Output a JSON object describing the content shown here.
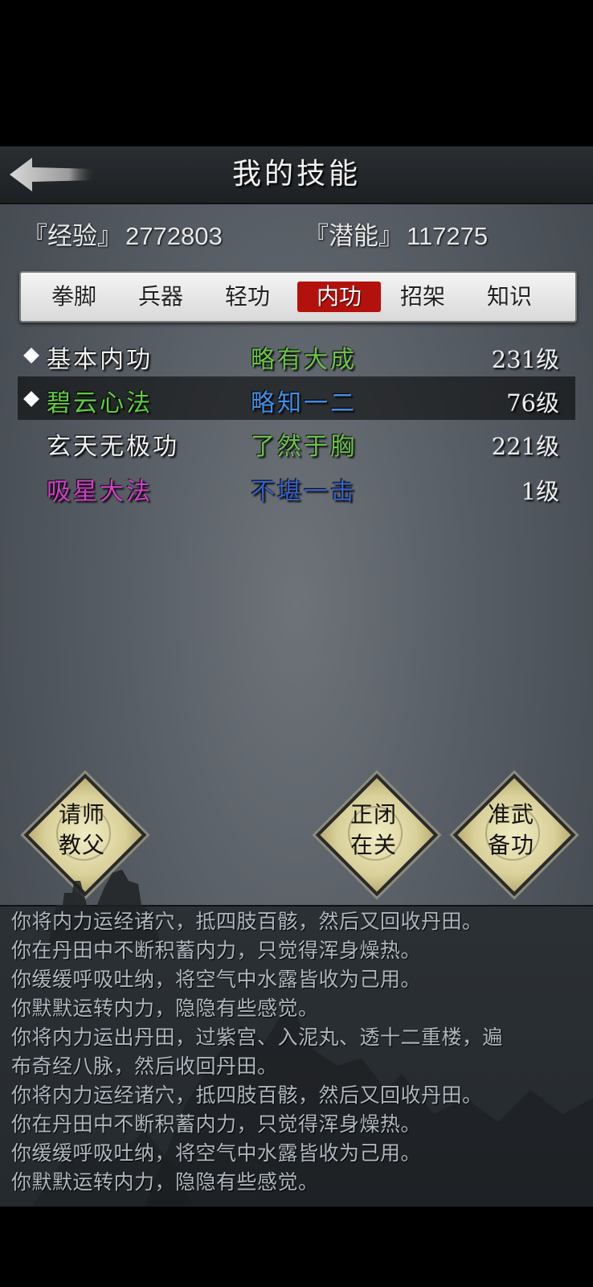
{
  "header": {
    "title": "我的技能",
    "back_icon": "back-arrow-icon"
  },
  "stats": {
    "exp_label": "『经验』",
    "exp_value": "2772803",
    "potential_label": "『潜能』",
    "potential_value": "117275"
  },
  "tabs": [
    {
      "label": "拳脚",
      "active": false
    },
    {
      "label": "兵器",
      "active": false
    },
    {
      "label": "轻功",
      "active": false
    },
    {
      "label": "内功",
      "active": true
    },
    {
      "label": "招架",
      "active": false
    },
    {
      "label": "知识",
      "active": false
    }
  ],
  "skills": [
    {
      "name": "基本内功",
      "rank": "略有大成",
      "level": "231级",
      "marked": true,
      "selected": false,
      "name_color": "#f0f0f0",
      "rank_color": "#6cc24a"
    },
    {
      "name": "碧云心法",
      "rank": "略知一二",
      "level": "76级",
      "marked": true,
      "selected": true,
      "name_color": "#5dcf3c",
      "rank_color": "#3f8fe8"
    },
    {
      "name": "玄天无极功",
      "rank": "了然于胸",
      "level": "221级",
      "marked": false,
      "selected": false,
      "name_color": "#f0f0f0",
      "rank_color": "#6cc24a"
    },
    {
      "name": "吸星大法",
      "rank": "不堪一击",
      "level": "1级",
      "marked": false,
      "selected": false,
      "name_color": "#d23fc8",
      "rank_color": "#3560c8"
    }
  ],
  "actions": {
    "teacher": {
      "line1": "请师",
      "line2": "教父"
    },
    "close": {
      "line1": "正闭",
      "line2": "在关"
    },
    "prepare": {
      "line1": "准武",
      "line2": "备功"
    }
  },
  "log": [
    "你将内力运经诸穴，抵四肢百骸，然后又回收丹田。",
    "你在丹田中不断积蓄内力，只觉得浑身燥热。",
    "你缓缓呼吸吐纳，将空气中水露皆收为己用。",
    "你默默运转内力，隐隐有些感觉。",
    "你将内力运出丹田，过紫宫、入泥丸、透十二重楼，遍",
    "布奇经八脉，然后收回丹田。",
    "你将内力运经诸穴，抵四肢百骸，然后又回收丹田。",
    "你在丹田中不断积蓄内力，只觉得浑身燥热。",
    "你缓缓呼吸吐纳，将空气中水露皆收为己用。",
    "你默默运转内力，隐隐有些感觉。"
  ]
}
